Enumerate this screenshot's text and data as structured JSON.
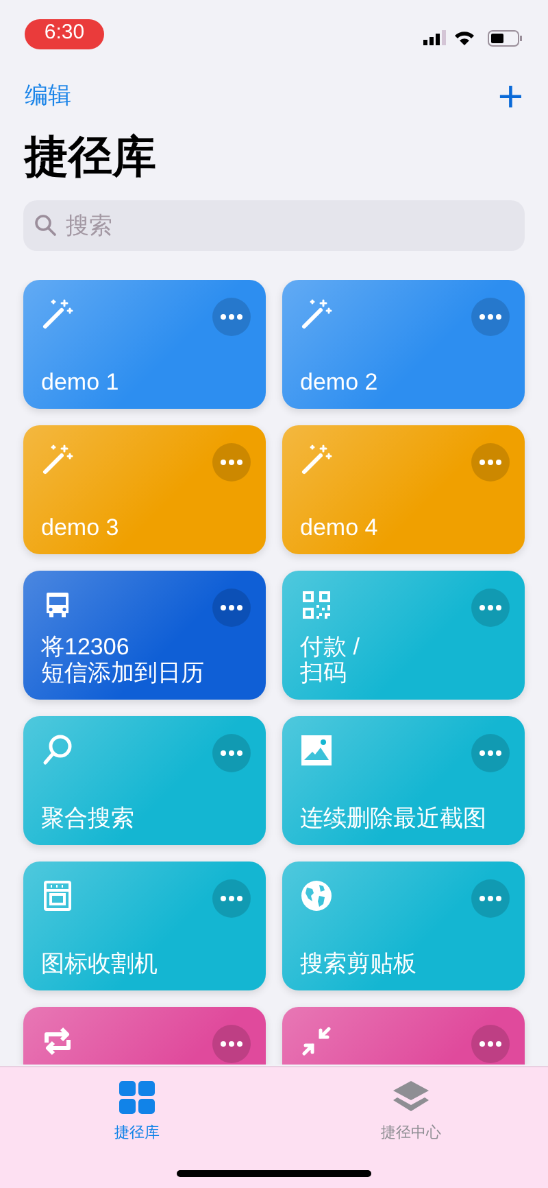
{
  "status_bar": {
    "time": "6:30"
  },
  "nav": {
    "edit": "编辑",
    "add": "+"
  },
  "title": "捷径库",
  "search": {
    "placeholder": "搜索"
  },
  "shortcuts": [
    {
      "title": "demo 1",
      "kind": "wand",
      "color": "#2d8ef0"
    },
    {
      "title": "demo 2",
      "kind": "wand",
      "color": "#2d8ef0"
    },
    {
      "title": "demo 3",
      "kind": "wand",
      "color": "#f0a000"
    },
    {
      "title": "demo 4",
      "kind": "wand",
      "color": "#f0a000"
    },
    {
      "title": "将12306\n短信添加到日历",
      "kind": "bus",
      "color": "#0f5fd6"
    },
    {
      "title": "付款 /\n扫码",
      "kind": "qr",
      "color": "#14b6d2"
    },
    {
      "title": "聚合搜索",
      "kind": "search",
      "color": "#14b6d2"
    },
    {
      "title": "连续删除最近截图",
      "kind": "image",
      "color": "#14b6d2"
    },
    {
      "title": "图标收割机",
      "kind": "printer",
      "color": "#14b6d2"
    },
    {
      "title": "搜索剪贴板",
      "kind": "globe",
      "color": "#14b6d2"
    },
    {
      "kind": "repeat",
      "color": "#e04a9c"
    },
    {
      "kind": "shrink",
      "color": "#e04a9c"
    }
  ],
  "tab_bar": [
    {
      "label": "捷径库",
      "kind": "grid",
      "selected": true
    },
    {
      "label": "捷径中心",
      "kind": "layers",
      "selected": false
    }
  ]
}
